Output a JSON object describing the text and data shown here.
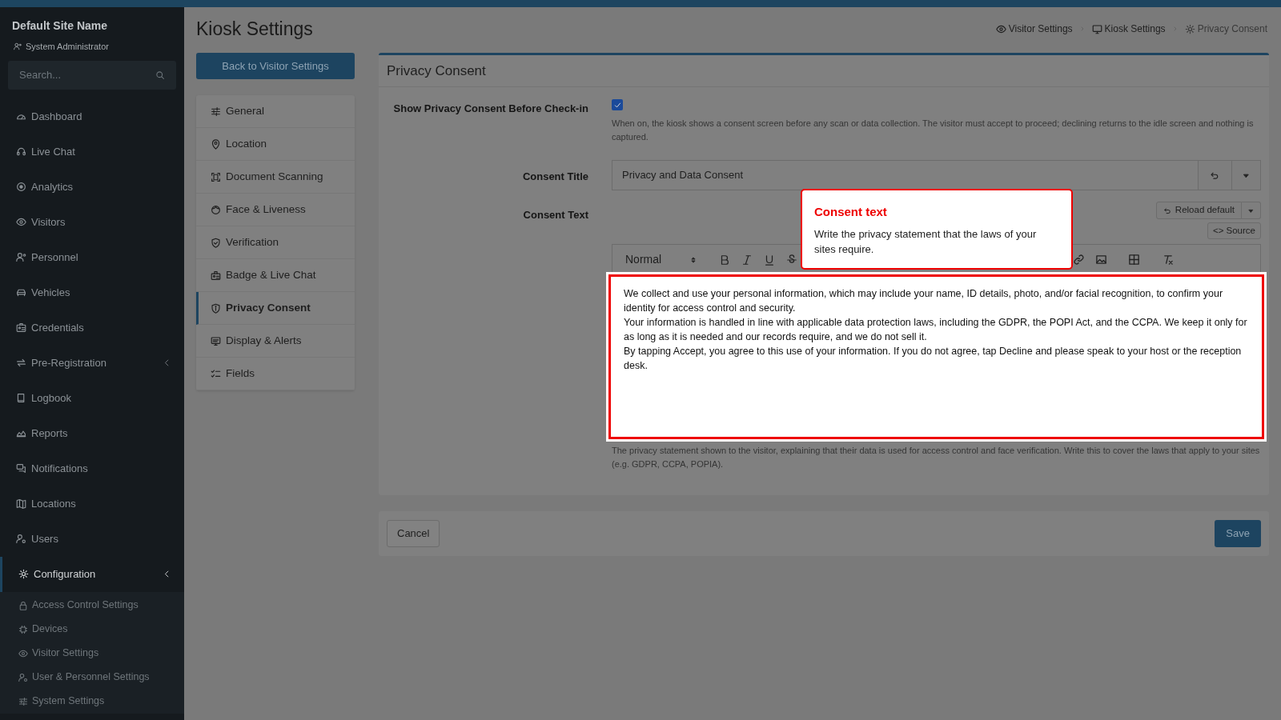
{
  "sidebar": {
    "site_name": "Default Site Name",
    "user": "System Administrator",
    "search": {
      "placeholder": "Search..."
    },
    "items": [
      {
        "label": "Dashboard",
        "selected": false
      },
      {
        "label": "Live Chat",
        "selected": false
      },
      {
        "label": "Analytics",
        "selected": false
      },
      {
        "label": "Visitors",
        "selected": false
      },
      {
        "label": "Personnel",
        "selected": false
      },
      {
        "label": "Vehicles",
        "selected": false
      },
      {
        "label": "Credentials",
        "selected": false
      },
      {
        "label": "Pre-Registration",
        "selected": false,
        "expanded": false
      },
      {
        "label": "Logbook",
        "selected": false
      },
      {
        "label": "Reports",
        "selected": false
      },
      {
        "label": "Notifications",
        "selected": false
      },
      {
        "label": "Locations",
        "selected": false
      },
      {
        "label": "Users",
        "selected": false
      },
      {
        "label": "Configuration",
        "selected": true,
        "expanded": true,
        "children": [
          {
            "label": "Access Control Settings"
          },
          {
            "label": "Devices"
          },
          {
            "label": "Visitor Settings"
          },
          {
            "label": "User & Personnel Settings"
          },
          {
            "label": "System Settings"
          }
        ]
      }
    ]
  },
  "page": {
    "title": "Kiosk Settings",
    "breadcrumb": [
      "Visitor Settings",
      "Kiosk Settings",
      "Privacy Consent"
    ],
    "back_button": "Back to Visitor Settings"
  },
  "sections": [
    {
      "label": "General",
      "selected": false
    },
    {
      "label": "Location",
      "selected": false
    },
    {
      "label": "Document Scanning",
      "selected": false
    },
    {
      "label": "Face & Liveness",
      "selected": false
    },
    {
      "label": "Verification",
      "selected": false
    },
    {
      "label": "Badge & Live Chat",
      "selected": false
    },
    {
      "label": "Privacy Consent",
      "selected": true
    },
    {
      "label": "Display & Alerts",
      "selected": false
    },
    {
      "label": "Fields",
      "selected": false
    }
  ],
  "card": {
    "title": "Privacy Consent",
    "show_consent": {
      "label": "Show Privacy Consent Before Check-in",
      "checked": true,
      "help": "When on, the kiosk shows a consent screen before any scan or data collection. The visitor must accept to proceed; declining returns to the idle screen and nothing is captured."
    },
    "consent_title": {
      "label": "Consent Title",
      "value": "Privacy and Data Consent"
    },
    "consent_text": {
      "label": "Consent Text",
      "reload_button": "Reload default",
      "source_button": "<> Source",
      "format": "Normal",
      "paragraphs": [
        "We collect and use your personal information, which may include your name, ID details, photo, and/or facial recognition, to confirm your identity for access control and security.",
        "Your information is handled in line with applicable data protection laws, including the GDPR, the POPI Act, and the CCPA. We keep it only for as long as it is needed and our records require, and we do not sell it.",
        "By tapping Accept, you agree to this use of your information. If you do not agree, tap Decline and please speak to your host or the reception desk."
      ],
      "help": "The privacy statement shown to the visitor, explaining that their data is used for access control and face verification. Write this to cover the laws that apply to your sites (e.g. GDPR, CCPA, POPIA)."
    }
  },
  "footer": {
    "cancel": "Cancel",
    "save": "Save"
  },
  "tooltip": {
    "title": "Consent text",
    "body": "Write the privacy statement that the laws of your sites require."
  }
}
